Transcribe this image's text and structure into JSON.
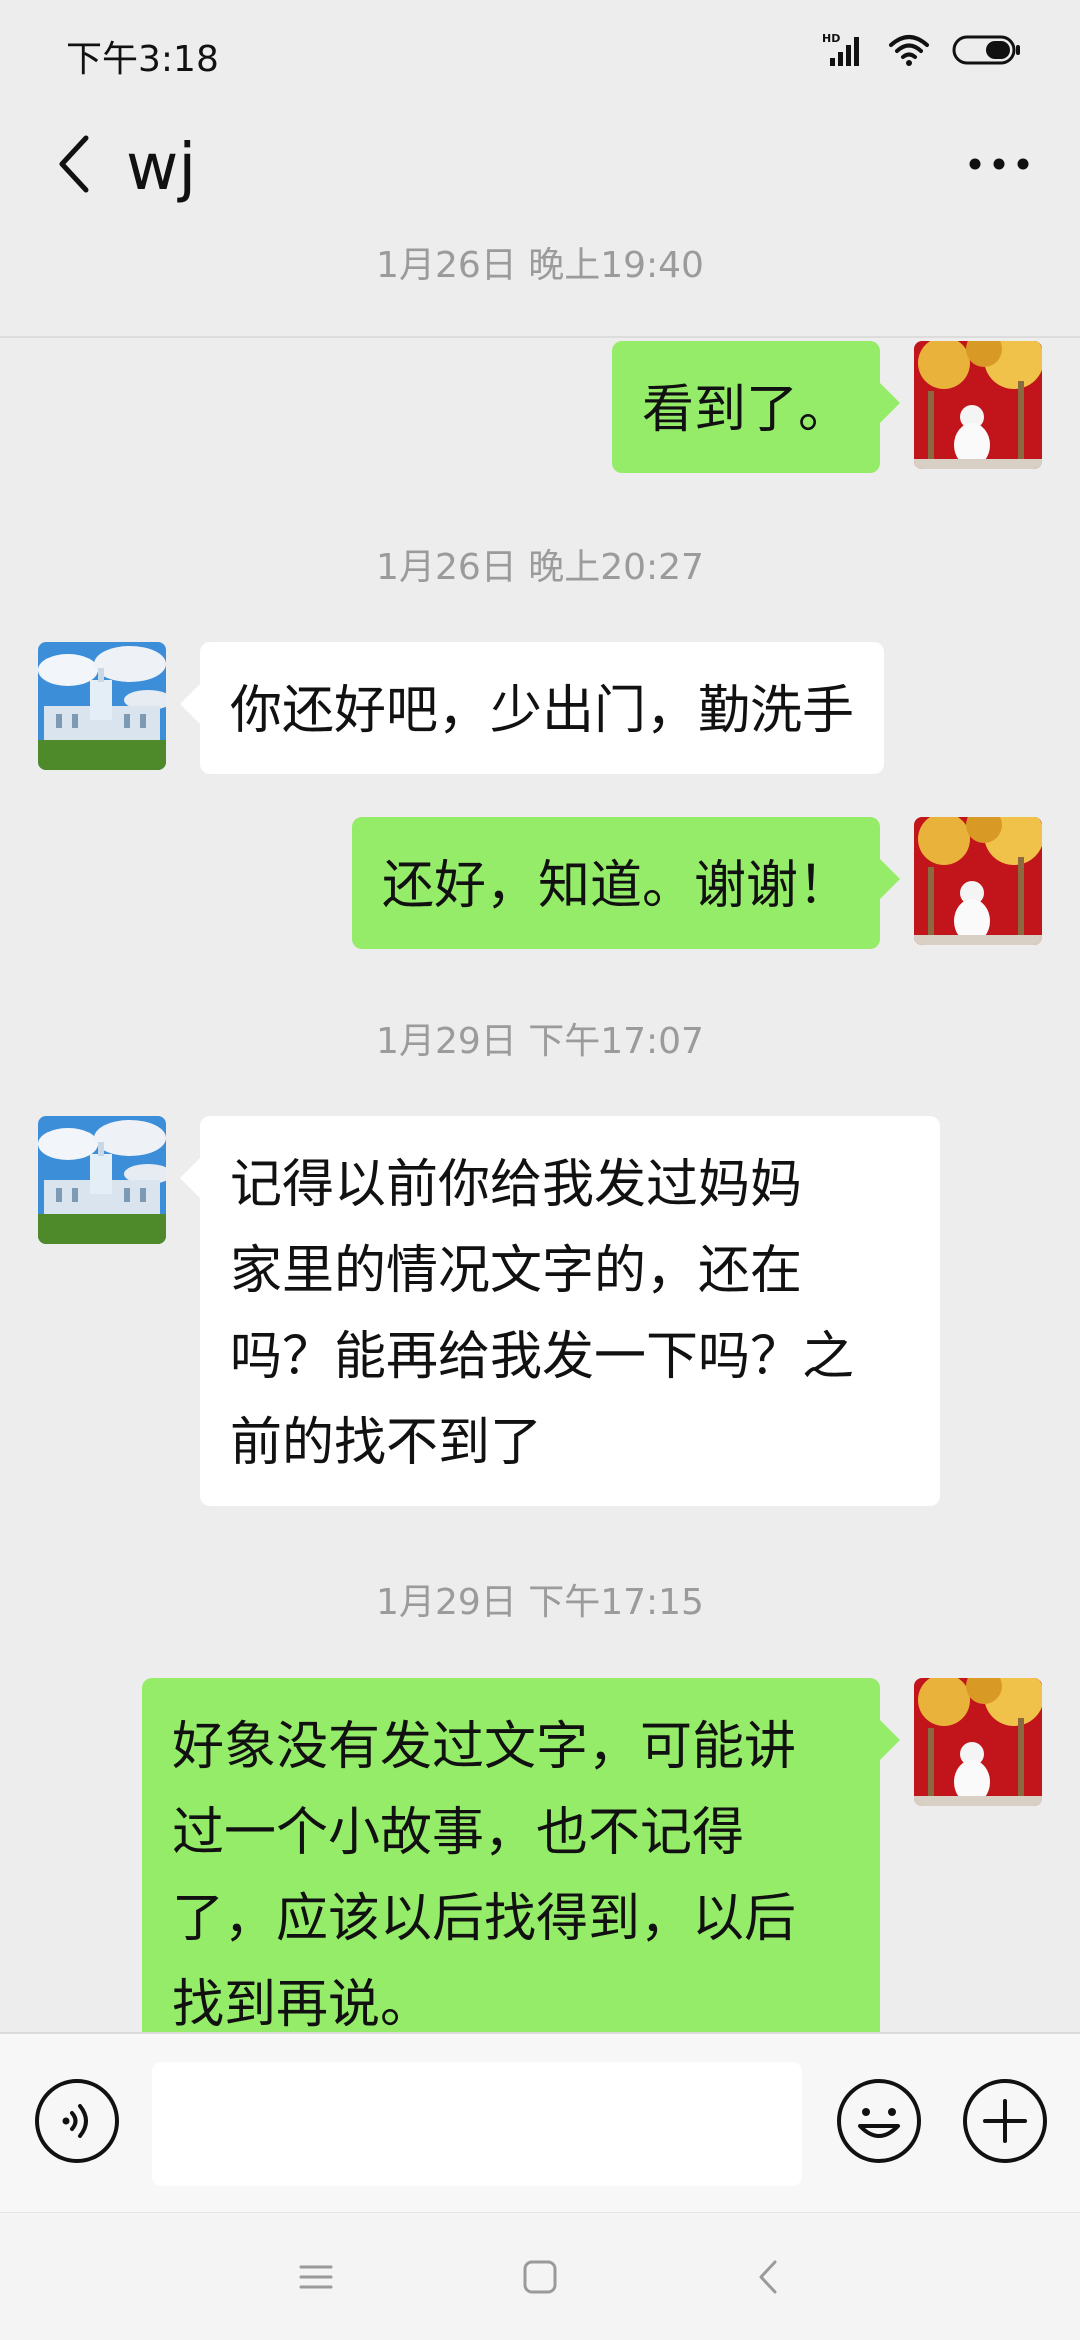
{
  "status_bar": {
    "time": "下午3:18",
    "network_label": "HD"
  },
  "header": {
    "title": "wj"
  },
  "messages": {
    "timestamps": [
      "1月26日 晚上19:40",
      "1月26日 晚上20:27",
      "1月29日 下午17:07",
      "1月29日 下午17:15"
    ],
    "items": [
      {
        "side": "out",
        "text": "看到了。"
      },
      {
        "side": "in",
        "text": "你还好吧，少出门，勤洗手"
      },
      {
        "side": "out",
        "text": "还好，知道。谢谢！"
      },
      {
        "side": "in",
        "lines": [
          "记得以前你给我发过妈妈",
          "家里的情况文字的，还在",
          "吗？能再给我发一下吗？之",
          "前的找不到了"
        ]
      },
      {
        "side": "out",
        "lines": [
          "好象没有发过文字，可能讲",
          "过一个小故事，也不记得",
          "了，应该以后找得到，以后",
          "找到再说。"
        ]
      }
    ]
  },
  "input_bar": {
    "value": "",
    "placeholder": ""
  },
  "colors": {
    "background": "#EDEDED",
    "bubble_out": "#95EC69",
    "bubble_in": "#FFFFFF",
    "timestamp": "#9B9B9B"
  },
  "icons": [
    "back-icon",
    "more-icon",
    "voice-icon",
    "emoji-icon",
    "plus-icon",
    "signal-icon",
    "wifi-icon",
    "battery-icon",
    "menu-nav-icon",
    "home-nav-icon",
    "back-nav-icon"
  ]
}
